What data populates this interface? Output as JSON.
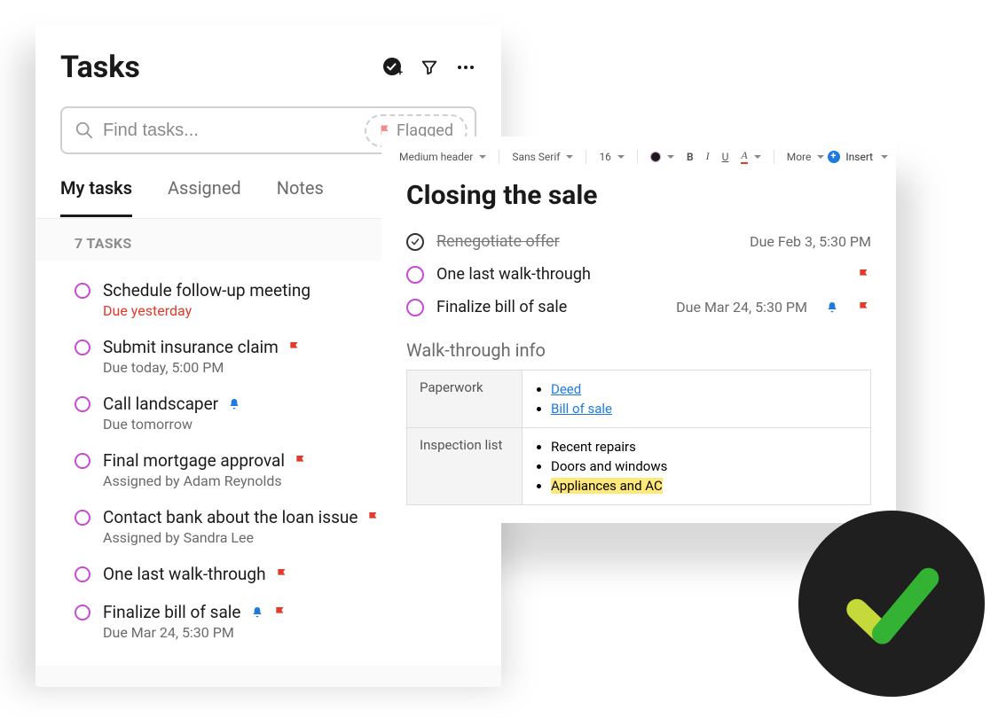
{
  "tasksPanel": {
    "title": "Tasks",
    "search": {
      "placeholder": "Find tasks..."
    },
    "flaggedChip": "Flagged",
    "tabs": [
      "My tasks",
      "Assigned",
      "Notes"
    ],
    "activeTab": 0,
    "countLabel": "7 TASKS",
    "tasks": [
      {
        "title": "Schedule follow-up meeting",
        "sub": "Due yesterday",
        "subClass": "overdue"
      },
      {
        "title": "Submit insurance claim",
        "sub": "Due today, 5:00 PM",
        "flag": true
      },
      {
        "title": "Call landscaper",
        "sub": "Due tomorrow",
        "bell": true
      },
      {
        "title": "Final mortgage approval",
        "sub": "Assigned by Adam Reynolds",
        "flag": true
      },
      {
        "title": "Contact bank about the loan issue",
        "sub": "Assigned by Sandra Lee",
        "flag": true
      },
      {
        "title": "One last walk-through",
        "flag": true
      },
      {
        "title": "Finalize bill of sale",
        "sub": "Due Mar 24, 5:30 PM",
        "bell": true,
        "flag": true
      }
    ]
  },
  "editor": {
    "toolbar": {
      "heading": "Medium header",
      "font": "Sans Serif",
      "size": "16",
      "more": "More",
      "insert": "Insert"
    },
    "title": "Closing the sale",
    "tasks": [
      {
        "done": true,
        "title": "Renegotiate offer",
        "due": "Due Feb 3, 5:30 PM"
      },
      {
        "done": false,
        "title": "One last walk-through",
        "flag": true
      },
      {
        "done": false,
        "title": "Finalize bill of sale",
        "due": "Due Mar 24, 5:30 PM",
        "bell": true,
        "flag": true
      }
    ],
    "sectionHeading": "Walk-through info",
    "table": {
      "rows": [
        {
          "key": "Paperwork",
          "links": [
            "Deed",
            "Bill of sale"
          ]
        },
        {
          "key": "Inspection list",
          "items": [
            "Recent repairs",
            "Doors and windows"
          ],
          "highlight": "Appliances and AC"
        }
      ]
    }
  }
}
